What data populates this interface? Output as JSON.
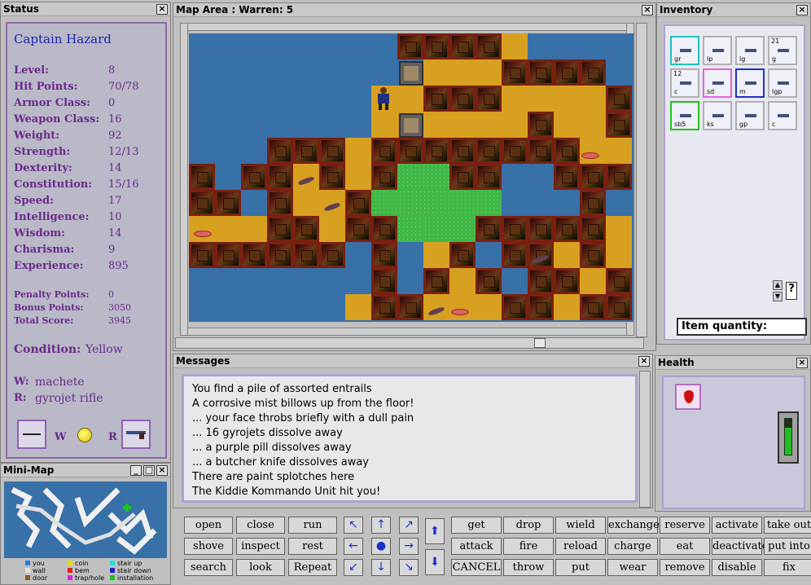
{
  "status": {
    "title": "Status",
    "name": "Captain Hazard",
    "stats": [
      {
        "label": "Level:",
        "value": "8"
      },
      {
        "label": "Hit Points:",
        "value": "70/78"
      },
      {
        "label": "Armor Class:",
        "value": "0"
      },
      {
        "label": "Weapon Class:",
        "value": "16"
      },
      {
        "label": "Weight:",
        "value": "92"
      },
      {
        "label": "Strength:",
        "value": "12/13"
      },
      {
        "label": "Dexterity:",
        "value": "14"
      },
      {
        "label": "Constitution:",
        "value": "15/16"
      },
      {
        "label": "Speed:",
        "value": "17"
      },
      {
        "label": "Intelligence:",
        "value": "10"
      },
      {
        "label": "Wisdom:",
        "value": "14"
      },
      {
        "label": "Charisma:",
        "value": "9"
      },
      {
        "label": "Experience:",
        "value": "895"
      }
    ],
    "points": [
      {
        "label": "Penalty Points:",
        "value": "0"
      },
      {
        "label": "Bonus Points:",
        "value": "3050"
      },
      {
        "label": "Total Score:",
        "value": "3945"
      }
    ],
    "condition_label": "Condition:",
    "condition_value": "Yellow",
    "w_label": "W:",
    "w_value": "machete",
    "r_label": "R:",
    "r_value": "gyrojet rifle",
    "slot_w": "W",
    "slot_r": "R"
  },
  "map": {
    "title": "Map Area : Warren: 5"
  },
  "inventory": {
    "title": "Inventory",
    "items": [
      "gr",
      "lp",
      "lg",
      "g",
      "c",
      "sd",
      "m",
      "lgp",
      "sb5",
      "ks",
      "gp",
      "c"
    ],
    "item_counts": [
      "",
      "",
      "",
      "21",
      "12",
      "",
      "",
      "",
      "",
      "",
      "",
      ""
    ],
    "help": "?",
    "quantity_label": "Item quantity:"
  },
  "messages": {
    "title": "Messages",
    "lines": [
      "You find a pile of assorted entrails",
      "A corrosive mist billows up from the floor!",
      "... your face throbs briefly with a dull pain",
      "... 16 gyrojets dissolve away",
      "... a purple pill dissolves away",
      "... a butcher knife dissolves away",
      "There are paint splotches here",
      "The Kiddie Kommando Unit hit you!"
    ]
  },
  "health": {
    "title": "Health",
    "level": 0.75
  },
  "minimap": {
    "title": "Mini-Map",
    "legend": [
      {
        "label": "you",
        "color": "#2080e0"
      },
      {
        "label": "coin",
        "color": "#e0e000"
      },
      {
        "label": "stair up",
        "color": "#20e0e0"
      },
      {
        "label": "wall",
        "color": "#e0e0e0"
      },
      {
        "label": "bem",
        "color": "#e02020"
      },
      {
        "label": "stair down",
        "color": "#2020c0"
      },
      {
        "label": "door",
        "color": "#8a5a20"
      },
      {
        "label": "trap/hole",
        "color": "#e020e0"
      },
      {
        "label": "installation",
        "color": "#20c020"
      }
    ]
  },
  "commands": {
    "left": [
      [
        "open",
        "close",
        "run"
      ],
      [
        "shove",
        "inspect",
        "rest"
      ],
      [
        "search",
        "look",
        "Repeat"
      ]
    ],
    "right": [
      [
        "get",
        "drop",
        "wield",
        "exchange",
        "reserve",
        "activate",
        "take out"
      ],
      [
        "attack",
        "fire",
        "reload",
        "charge",
        "eat",
        "deactivate",
        "put into"
      ],
      [
        "CANCEL",
        "throw",
        "put",
        "wear",
        "remove",
        "disable",
        "fix"
      ]
    ],
    "arrows": [
      "↖",
      "↑",
      "↗",
      "←",
      "●",
      "→",
      "↙",
      "↓",
      "↘"
    ],
    "updown": [
      "⬆",
      "⬇"
    ]
  }
}
